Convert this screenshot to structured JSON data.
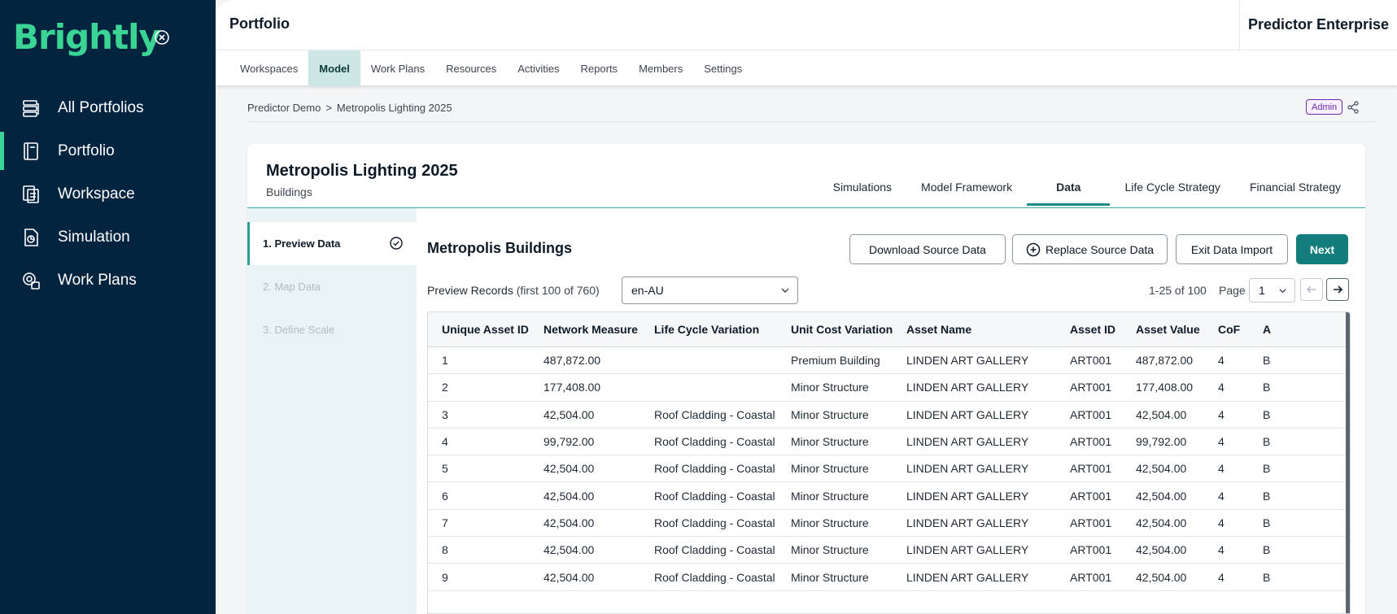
{
  "brand": {
    "name": "Brightly"
  },
  "sidebar": {
    "items": [
      {
        "label": "All Portfolios",
        "icon": "portfolios-icon"
      },
      {
        "label": "Portfolio",
        "icon": "book-icon",
        "active": true
      },
      {
        "label": "Workspace",
        "icon": "workspace-icon"
      },
      {
        "label": "Simulation",
        "icon": "simulation-icon"
      },
      {
        "label": "Work Plans",
        "icon": "work-plans-icon"
      }
    ]
  },
  "header": {
    "title": "Portfolio",
    "product": "Predictor Enterprise"
  },
  "subnav": {
    "items": [
      "Workspaces",
      "Model",
      "Work Plans",
      "Resources",
      "Activities",
      "Reports",
      "Members",
      "Settings"
    ],
    "active": "Model"
  },
  "breadcrumb": {
    "root": "Predictor Demo",
    "current": "Metropolis Lighting 2025",
    "separator": ">"
  },
  "badge": {
    "role": "Admin"
  },
  "card": {
    "title": "Metropolis Lighting 2025",
    "subtitle": "Buildings",
    "tabs": [
      "Simulations",
      "Model Framework",
      "Data",
      "Life Cycle Strategy",
      "Financial Strategy"
    ],
    "active_tab": "Data"
  },
  "steps": [
    {
      "label": "1. Preview Data",
      "state": "done"
    },
    {
      "label": "2. Map Data",
      "state": "disabled"
    },
    {
      "label": "3. Define Scale",
      "state": "disabled"
    }
  ],
  "data_panel": {
    "title": "Metropolis Buildings",
    "buttons": {
      "download": "Download Source Data",
      "replace": "Replace Source Data",
      "exit": "Exit Data Import",
      "next": "Next"
    },
    "records_label": "Preview Records",
    "records_note": "(first 100 of 760)",
    "locale": "en-AU",
    "pager": {
      "range": "1-25 of 100",
      "page_label": "Page",
      "page": "1"
    }
  },
  "table": {
    "columns": [
      "Unique Asset ID",
      "Network Measure",
      "Life Cycle Variation",
      "Unit Cost Variation",
      "Asset Name",
      "Asset ID",
      "Asset Value",
      "CoF",
      "A"
    ],
    "rows": [
      [
        "1",
        "487,872.00",
        "",
        "Premium Building",
        "LINDEN ART GALLERY",
        "ART001",
        "487,872.00",
        "4",
        "B"
      ],
      [
        "2",
        "177,408.00",
        "",
        "Minor Structure",
        "LINDEN ART GALLERY",
        "ART001",
        "177,408.00",
        "4",
        "B"
      ],
      [
        "3",
        "42,504.00",
        "Roof Cladding - Coastal",
        "Minor Structure",
        "LINDEN ART GALLERY",
        "ART001",
        "42,504.00",
        "4",
        "B"
      ],
      [
        "4",
        "99,792.00",
        "Roof Cladding - Coastal",
        "Minor Structure",
        "LINDEN ART GALLERY",
        "ART001",
        "99,792.00",
        "4",
        "B"
      ],
      [
        "5",
        "42,504.00",
        "Roof Cladding - Coastal",
        "Minor Structure",
        "LINDEN ART GALLERY",
        "ART001",
        "42,504.00",
        "4",
        "B"
      ],
      [
        "6",
        "42,504.00",
        "Roof Cladding - Coastal",
        "Minor Structure",
        "LINDEN ART GALLERY",
        "ART001",
        "42,504.00",
        "4",
        "B"
      ],
      [
        "7",
        "42,504.00",
        "Roof Cladding - Coastal",
        "Minor Structure",
        "LINDEN ART GALLERY",
        "ART001",
        "42,504.00",
        "4",
        "B"
      ],
      [
        "8",
        "42,504.00",
        "Roof Cladding - Coastal",
        "Minor Structure",
        "LINDEN ART GALLERY",
        "ART001",
        "42,504.00",
        "4",
        "B"
      ],
      [
        "9",
        "42,504.00",
        "Roof Cladding - Coastal",
        "Minor Structure",
        "LINDEN ART GALLERY",
        "ART001",
        "42,504.00",
        "4",
        "B"
      ]
    ]
  },
  "colors": {
    "sidebar": "#02243f",
    "brand": "#3ad494",
    "accent": "#127d7a",
    "admin": "#6b2aa8"
  }
}
